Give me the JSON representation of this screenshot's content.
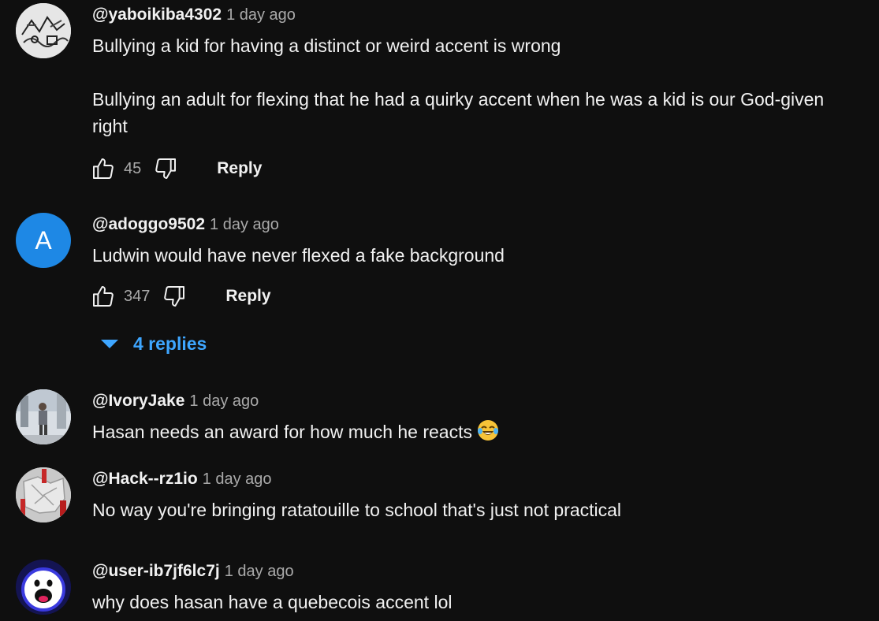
{
  "comments": [
    {
      "handle": "@yaboikiba4302",
      "time": "1 day ago",
      "paragraphs": [
        "Bullying a kid for having a distinct or weird accent is wrong",
        "Bullying an adult for flexing that he had a quirky accent when he was a kid is our God-given right"
      ],
      "likes": "45",
      "reply_label": "Reply",
      "avatar": "sketch-avatar"
    },
    {
      "handle": "@adoggo9502",
      "time": "1 day ago",
      "paragraphs": [
        "Ludwin would have never flexed a fake background"
      ],
      "likes": "347",
      "reply_label": "Reply",
      "avatar_letter": "A",
      "avatar_color": "#1e88e5",
      "replies_label": "4 replies"
    },
    {
      "handle": "@IvoryJake",
      "time": "1 day ago",
      "paragraphs": [
        "Hasan needs an award for how much he reacts"
      ],
      "emoji": "laughing-tears-emoji",
      "avatar": "photo-avatar"
    },
    {
      "handle": "@Hack--rz1io",
      "time": "1 day ago",
      "paragraphs": [
        "No way you're bringing ratatouille to school that's just not practical"
      ],
      "avatar": "crumpled-paper-avatar"
    },
    {
      "handle": "@user-ib7jf6lc7j",
      "time": "1 day ago",
      "paragraphs": [
        "why does hasan have a quebecois accent lol"
      ],
      "avatar": "ghost-avatar"
    }
  ],
  "colors": {
    "background": "#0f0f0f",
    "link_blue": "#3ea6ff",
    "secondary_text": "#aaaaaa"
  }
}
